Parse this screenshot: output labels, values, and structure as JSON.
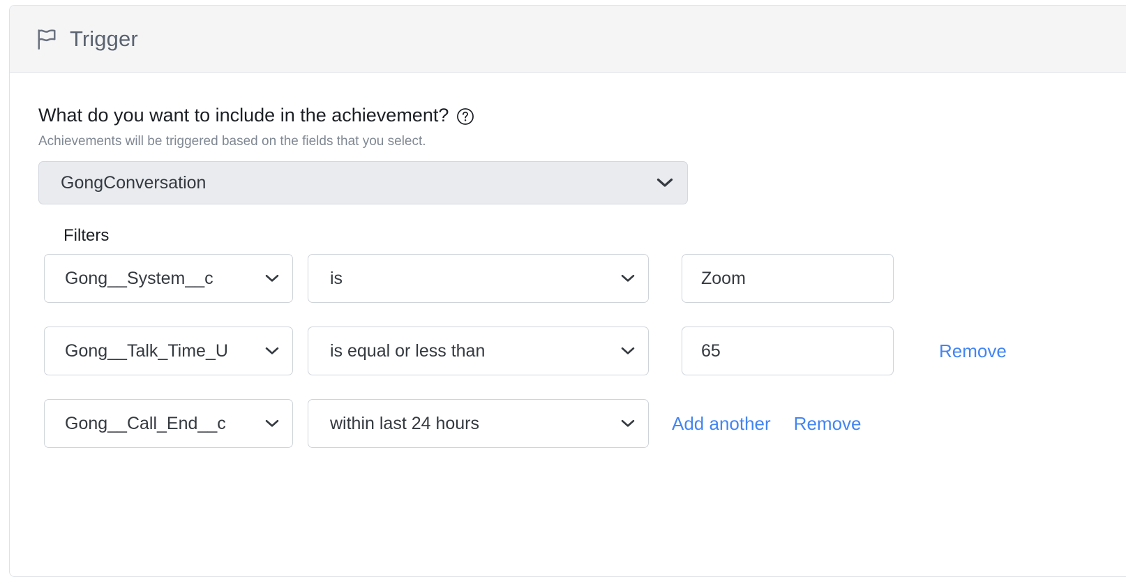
{
  "card": {
    "header": {
      "icon": "flag-icon",
      "title": "Trigger"
    },
    "question": {
      "text": "What do you want to include in the achievement?",
      "help_icon": "help-circle-icon",
      "subtext": "Achievements will be triggered based on the fields that you select."
    },
    "object_select": {
      "value": "GongConversation",
      "chevron_icon": "chevron-down-icon"
    },
    "filters": {
      "label": "Filters",
      "rows": [
        {
          "field": "Gong__System__c",
          "operator": "is",
          "value": "Zoom",
          "has_value_input": true,
          "links": []
        },
        {
          "field": "Gong__Talk_Time_U",
          "operator": "is equal or less than",
          "value": "65",
          "has_value_input": true,
          "links": [
            "Remove"
          ]
        },
        {
          "field": "Gong__Call_End__c",
          "operator": "within last 24 hours",
          "value": "",
          "has_value_input": false,
          "links": [
            "Add another",
            "Remove"
          ]
        }
      ],
      "link_labels": {
        "add_another": "Add another",
        "remove": "Remove"
      }
    }
  },
  "colors": {
    "link": "#4285f4",
    "header_bg": "#f5f5f6",
    "border": "#dee2e6",
    "select_bg": "#e9ebef",
    "text": "#212529",
    "muted_text": "#808893"
  }
}
